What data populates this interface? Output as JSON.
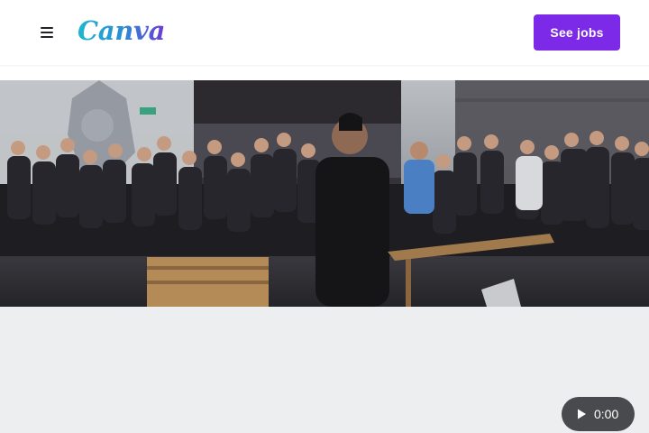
{
  "header": {
    "menu_icon": "hamburger-menu-icon",
    "logo_text": "Canva",
    "cta_label": "See jobs",
    "brand_color": "#7d2ae8",
    "logo_gradient": [
      "#1fb6d0",
      "#6c3bd5"
    ]
  },
  "hero": {
    "scene": "team-meeting-photo"
  },
  "video": {
    "play_icon": "play-icon",
    "time": "0:00"
  }
}
